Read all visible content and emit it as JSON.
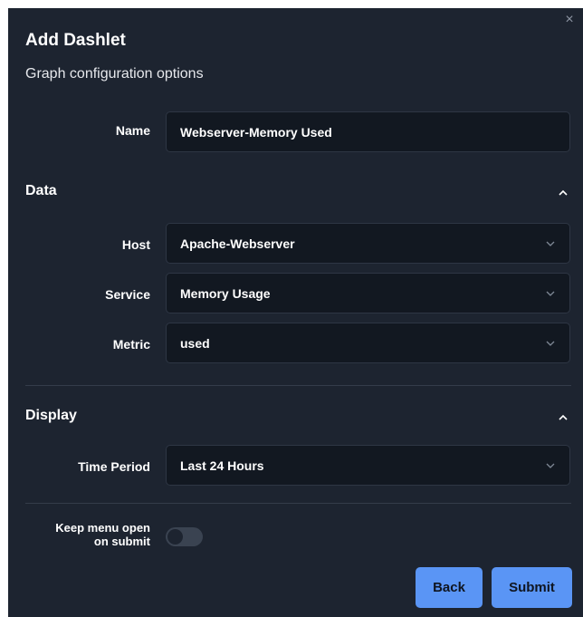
{
  "dialog": {
    "title": "Add Dashlet",
    "subtitle": "Graph configuration options",
    "close_symbol": "×"
  },
  "name_field": {
    "label": "Name",
    "value": "Webserver-Memory Used"
  },
  "data_section": {
    "title": "Data",
    "expanded": true,
    "host": {
      "label": "Host",
      "value": "Apache-Webserver"
    },
    "service": {
      "label": "Service",
      "value": "Memory Usage"
    },
    "metric": {
      "label": "Metric",
      "value": "used"
    }
  },
  "display_section": {
    "title": "Display",
    "expanded": true,
    "time_period": {
      "label": "Time Period",
      "value": "Last 24 Hours"
    }
  },
  "keep_menu": {
    "label_line1": "Keep menu open",
    "label_line2": "on submit",
    "enabled": false
  },
  "buttons": {
    "back": "Back",
    "submit": "Submit"
  },
  "icons": {
    "close": "close-icon",
    "collapse": "chevron-up-icon",
    "dropdown": "chevron-down-icon"
  },
  "colors": {
    "dialog_bg": "#1d2430",
    "field_bg": "#121821",
    "accent": "#5a95f5"
  }
}
